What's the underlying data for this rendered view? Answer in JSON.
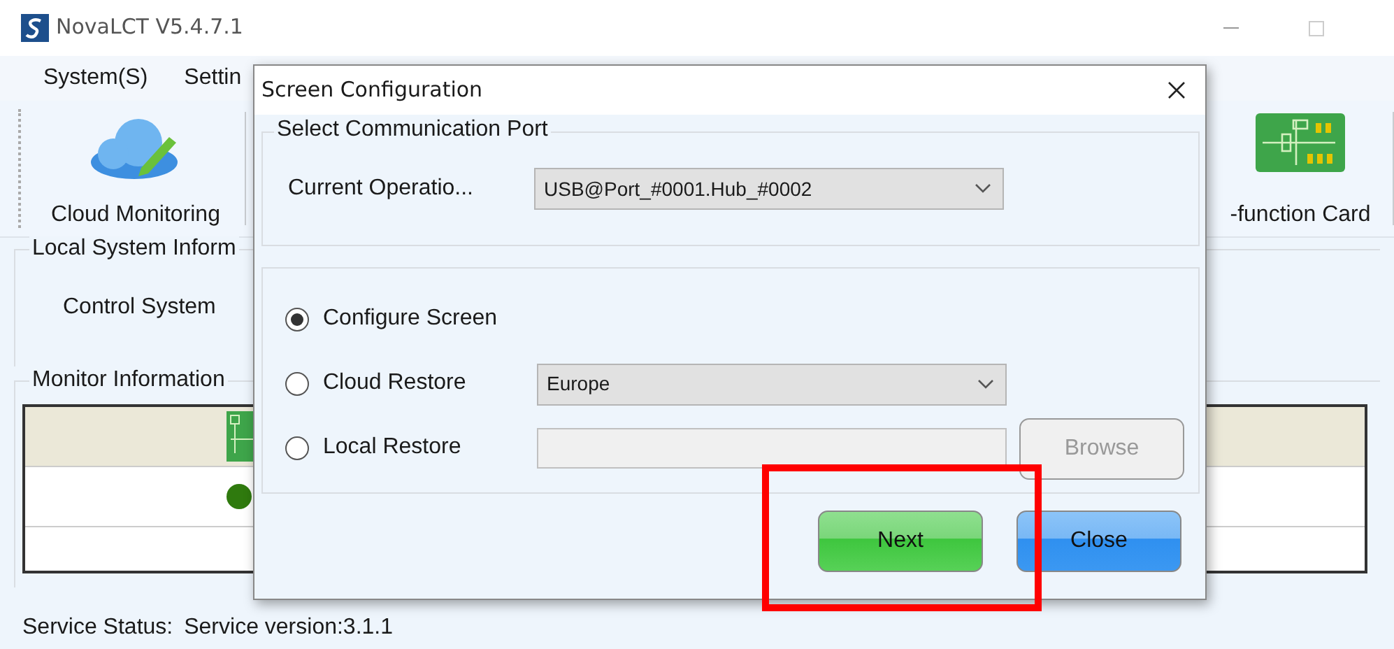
{
  "window": {
    "title": "NovaLCT V5.4.7.1"
  },
  "menu": [
    {
      "label": "System(S)"
    },
    {
      "label": "Settin"
    }
  ],
  "toolbar": [
    {
      "label": "Cloud Monitoring",
      "kind": "cloud"
    },
    {
      "label": "-function Card",
      "kind": "card"
    }
  ],
  "local_system_info": {
    "legend": "Local System Inform",
    "items": [
      "Control System"
    ]
  },
  "monitor_info": {
    "legend": "Monitor Information"
  },
  "status_bar": {
    "label": "Service Status:",
    "value": "Service version:3.1.1"
  },
  "dialog": {
    "title": "Screen Configuration",
    "port_group": {
      "legend": "Select Communication Port",
      "label": "Current Operatio...",
      "value": "USB@Port_#0001.Hub_#0002"
    },
    "options": [
      {
        "label": "Configure Screen",
        "selected": true,
        "kind": "plain"
      },
      {
        "label": "Cloud Restore",
        "selected": false,
        "kind": "dropdown",
        "value": "Europe"
      },
      {
        "label": "Local Restore",
        "selected": false,
        "kind": "file",
        "browse": {
          "label": "Browse",
          "disabled": true
        }
      }
    ],
    "buttons": [
      {
        "label": "Next",
        "kind": "green"
      },
      {
        "label": "Close",
        "kind": "blue"
      }
    ]
  },
  "annotation": {
    "kind": "rectangle"
  }
}
